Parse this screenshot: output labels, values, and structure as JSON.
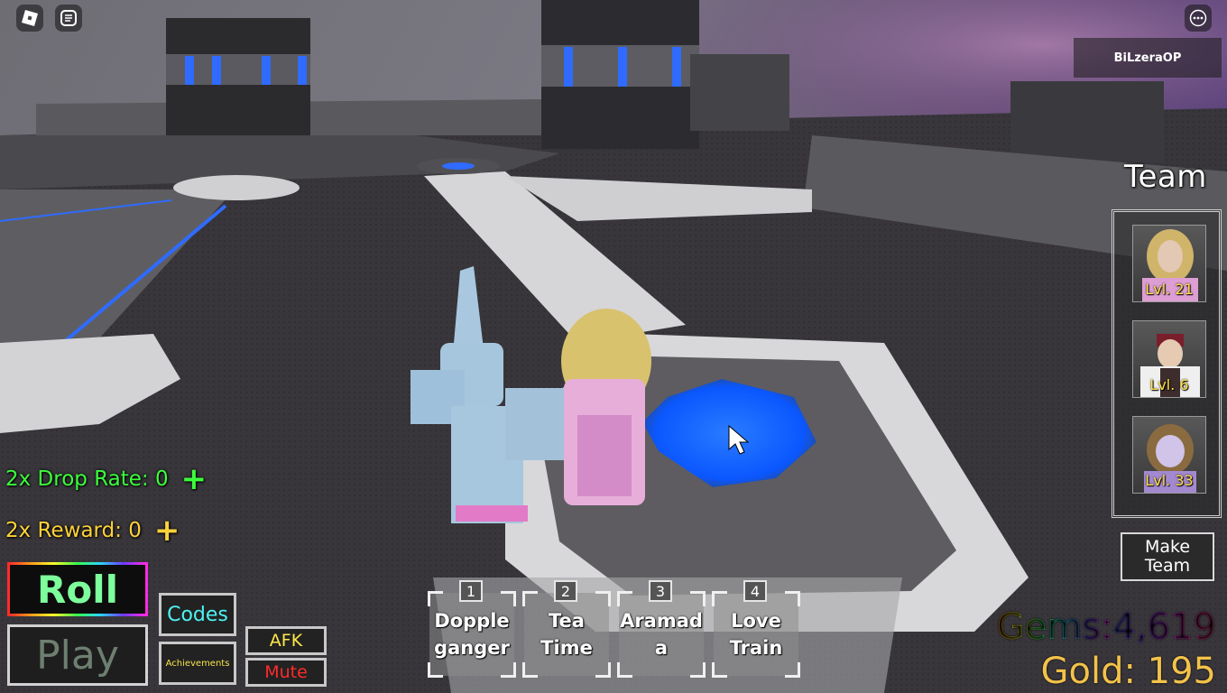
{
  "topbar": {
    "username": "BiLzeraOP"
  },
  "team": {
    "title": "Team",
    "slots": [
      {
        "level": "Lvl. 21"
      },
      {
        "level": "Lvl. 6"
      },
      {
        "level": "Lvl. 33"
      }
    ],
    "make_team_label": "Make Team"
  },
  "boosts": {
    "drop_rate": "2x Drop Rate: 0",
    "reward": "2x Reward: 0",
    "plus_symbol": "+"
  },
  "buttons": {
    "roll": "Roll",
    "play": "Play",
    "codes": "Codes",
    "achievements": "Achievements",
    "afk": "AFK",
    "mute": "Mute"
  },
  "hotbar": [
    {
      "key": "1",
      "name": "Dopple ganger"
    },
    {
      "key": "2",
      "name": "Tea Time"
    },
    {
      "key": "3",
      "name": "Aramad a"
    },
    {
      "key": "4",
      "name": "Love Train"
    }
  ],
  "currency": {
    "gems_label": "Gems: ",
    "gems_value": "4,619",
    "gold": "Gold: 195"
  },
  "colors": {
    "drop_rate": "#3cff3c",
    "reward": "#ffd23a",
    "roll_text": "#7dff9c",
    "codes_text": "#4ef2f2",
    "afk_text": "#ffe84a",
    "mute_text": "#ff2a2a",
    "level_text": "#ffe14a",
    "pad_glow": "#1f6bff"
  },
  "icons": [
    "roblox-logo-icon",
    "chat-icon",
    "more-options-icon",
    "mouse-cursor-icon"
  ]
}
